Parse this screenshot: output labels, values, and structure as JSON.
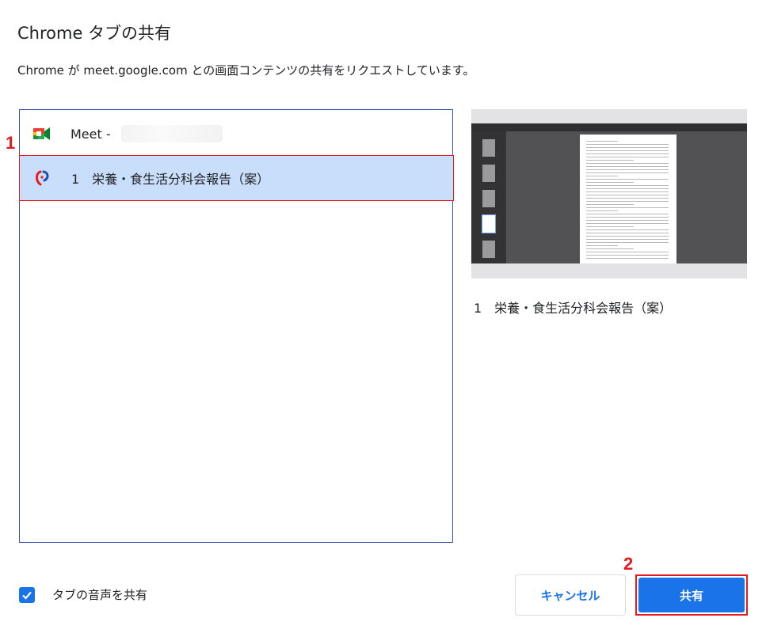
{
  "dialog": {
    "title": "Chrome タブの共有",
    "subtitle": "Chrome が meet.google.com との画面コンテンツの共有をリクエストしています。"
  },
  "tabs": [
    {
      "label": "Meet - ",
      "icon": "google-meet-icon",
      "selected": false
    },
    {
      "label": "1　栄養・食生活分科会報告（案）",
      "icon": "ministry-health-icon",
      "selected": true
    }
  ],
  "preview": {
    "caption": "1　栄養・食生活分科会報告（案）"
  },
  "footer": {
    "audio_label": "タブの音声を共有",
    "audio_checked": true,
    "cancel_label": "キャンセル",
    "share_label": "共有"
  },
  "annotations": [
    "1",
    "2"
  ],
  "colors": {
    "accent": "#1a73e8",
    "selected_row": "#c9defa",
    "annotation_red": "#e5191e"
  }
}
